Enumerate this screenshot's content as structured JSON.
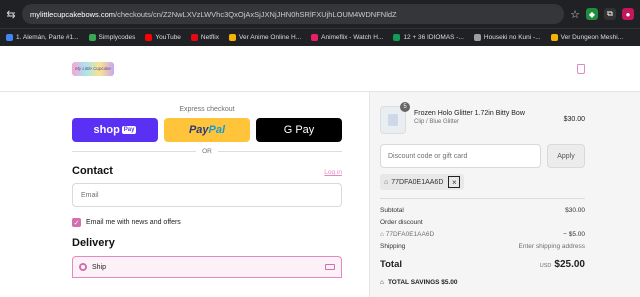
{
  "browser": {
    "url_domain": "mylittlecupcakebows.com",
    "url_path": "/checkouts/cn/Z2NwLXVzLWVhc3QxOjAxSjJXNjJHN0hSRlFXUjhLOUM4WDNFNldZ",
    "bookmarks": [
      {
        "label": "1. Alemán, Parte #1...",
        "color": "#4285f4"
      },
      {
        "label": "Simplycodes",
        "color": "#34a853"
      },
      {
        "label": "YouTube",
        "color": "#ff0000"
      },
      {
        "label": "Netflix",
        "color": "#e50914"
      },
      {
        "label": "Ver Anime Online H...",
        "color": "#f4b400"
      },
      {
        "label": "Animeflix - Watch H...",
        "color": "#e91e63"
      },
      {
        "label": "12 + 36 IDIOMAS -...",
        "color": "#0f9d58"
      },
      {
        "label": "Houseki no Kuni -...",
        "color": "#9e9e9e"
      },
      {
        "label": "Ver Dungeon Meshi...",
        "color": "#f4b400"
      }
    ]
  },
  "store": {
    "logo_text": "My Little Cupcake"
  },
  "express": {
    "title": "Express checkout",
    "shop": "shop",
    "shop_pay": "Pay",
    "paypal_a": "Pay",
    "paypal_b": "Pal",
    "gpay": "G Pay",
    "or": "OR"
  },
  "contact": {
    "heading": "Contact",
    "login": "Log in",
    "email_placeholder": "Email",
    "newsletter": "Email me with news and offers"
  },
  "delivery": {
    "heading": "Delivery",
    "ship": "Ship"
  },
  "cart": {
    "qty": "5",
    "product_name": "Frozen Holo Glitter 1.72in Bitty Bow",
    "product_variant": "Clip / Blue Glitter",
    "product_price": "$30.00",
    "discount_placeholder": "Discount code or gift card",
    "apply": "Apply",
    "code": "77DFA0E1AA6D"
  },
  "summary": {
    "subtotal_label": "Subtotal",
    "subtotal": "$30.00",
    "order_discount_label": "Order discount",
    "discount_code": "77DFA0E1AA6D",
    "discount_amount": "− $5.00",
    "shipping_label": "Shipping",
    "shipping_value": "Enter shipping address",
    "total_label": "Total",
    "currency": "USD",
    "total": "$25.00",
    "savings": "TOTAL SAVINGS  $5.00"
  }
}
